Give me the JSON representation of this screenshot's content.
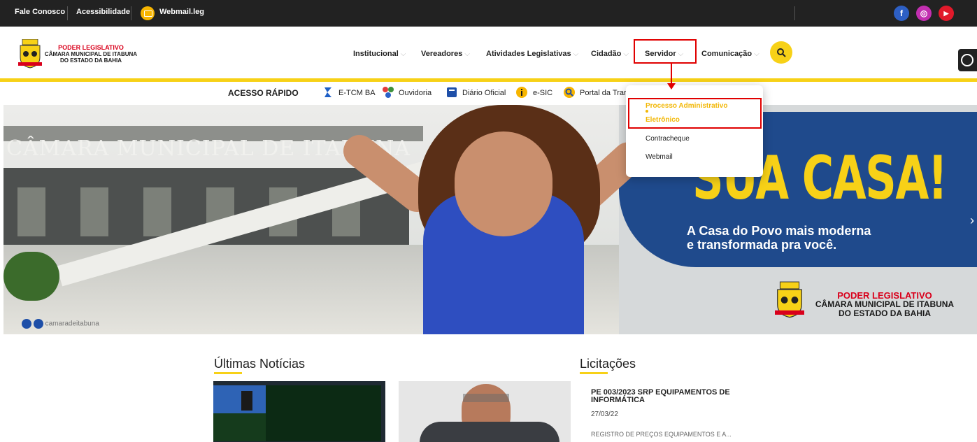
{
  "topbar": {
    "contact": "Fale Conosco",
    "accessibility": "Acessibilidade",
    "webmail": "Webmail.leg",
    "social": {
      "facebook": "f",
      "instagram": "◎",
      "youtube": "▶"
    }
  },
  "logo": {
    "line1": "PODER LEGISLATIVO",
    "line2": "CÂMARA MUNICIPAL DE ITABUNA",
    "line3": "DO ESTADO DA BAHIA"
  },
  "nav": {
    "items": [
      {
        "label": "Institucional"
      },
      {
        "label": "Vereadores"
      },
      {
        "label": "Atividades Legislativas"
      },
      {
        "label": "Cidadão"
      },
      {
        "label": "Servidor"
      },
      {
        "label": "Comunicação"
      }
    ],
    "chevron": "⌵"
  },
  "quick_access": {
    "label": "ACESSO RÁPIDO",
    "items": [
      {
        "label": "E-TCM BA"
      },
      {
        "label": "Ouvidoria"
      },
      {
        "label": "Diário Oficial"
      },
      {
        "label": "e-SIC"
      },
      {
        "label": "Portal da Trar"
      }
    ]
  },
  "dropdown": {
    "items": [
      {
        "label_line1": "Processo Administrativo",
        "label_line2": "Eletrônico"
      },
      {
        "label": "Contracheque"
      },
      {
        "label": "Webmail"
      }
    ]
  },
  "banner": {
    "building_title": "CÂMARA MUNICIPAL DE ITABUNA",
    "headline": "SUA CASA!",
    "tagline_line1": "A Casa do Povo mais moderna",
    "tagline_line2": "e transformada pra você.",
    "logo_line1": "PODER LEGISLATIVO",
    "logo_line2": "CÂMARA MUNICIPAL DE ITABUNA",
    "logo_line3": "DO ESTADO DA BAHIA",
    "social_handle": "camaradeitabuna",
    "next_arrow": "›"
  },
  "news": {
    "title": "Últimas Notícias"
  },
  "bids": {
    "title": "Licitações",
    "item": {
      "title": "PE 003/2023 SRP EQUIPAMENTOS DE INFORMÁTICA",
      "date": "27/03/22",
      "description": "REGISTRO DE PREÇOS EQUIPAMENTOS E A..."
    }
  },
  "colors": {
    "accent_yellow": "#f7d117",
    "dark_bar": "#222222",
    "brand_red": "#d9001b",
    "highlight_red": "#e00000",
    "banner_blue": "#1f4a8c"
  }
}
